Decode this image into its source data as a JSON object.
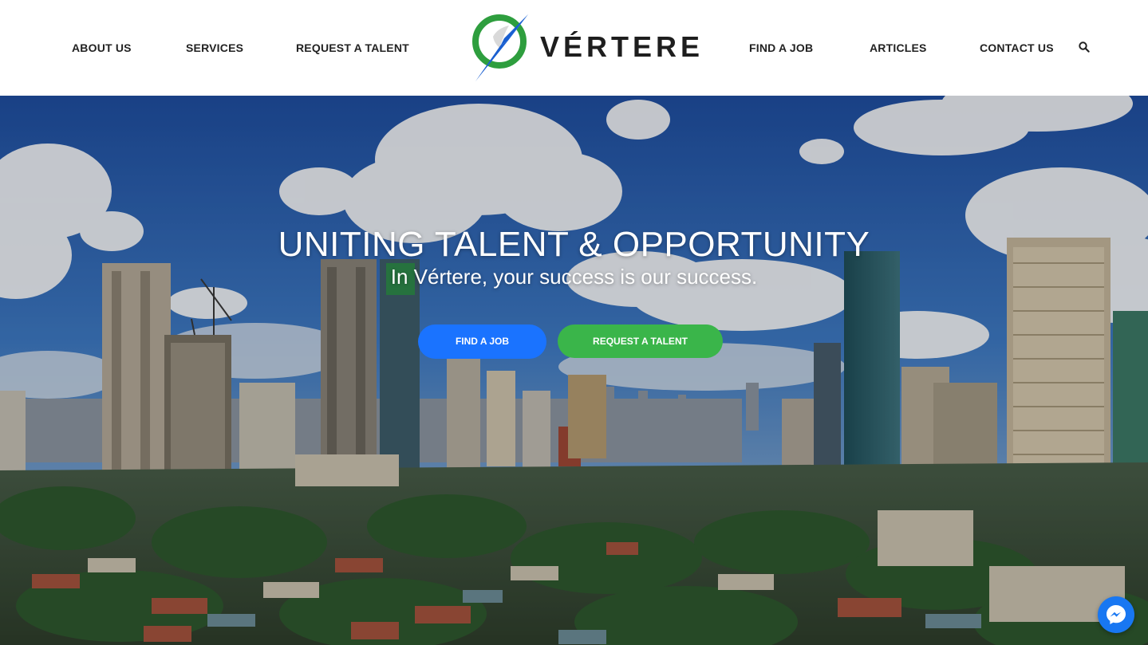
{
  "nav": {
    "about": "ABOUT US",
    "services": "SERVICES",
    "request_talent": "REQUEST A TALENT",
    "find_job": "FIND A JOB",
    "articles": "ARTICLES",
    "contact": "CONTACT US",
    "search_icon": "search-icon"
  },
  "logo": {
    "text": "VÉRTERE",
    "colors": {
      "ring": "#2e9e3e",
      "arrow": "#1a5fd0",
      "text": "#1e1e1e"
    }
  },
  "hero": {
    "title": "UNITING TALENT & OPPORTUNITY",
    "subtitle": "In Vértere, your success is our success.",
    "find_job_button": "FIND A JOB",
    "request_talent_button": "REQUEST A TALENT",
    "colors": {
      "find_job_button": "#1a73ff",
      "request_talent_button": "#3ab54a"
    }
  },
  "chat": {
    "icon": "messenger-icon",
    "color": "#1877f2"
  }
}
